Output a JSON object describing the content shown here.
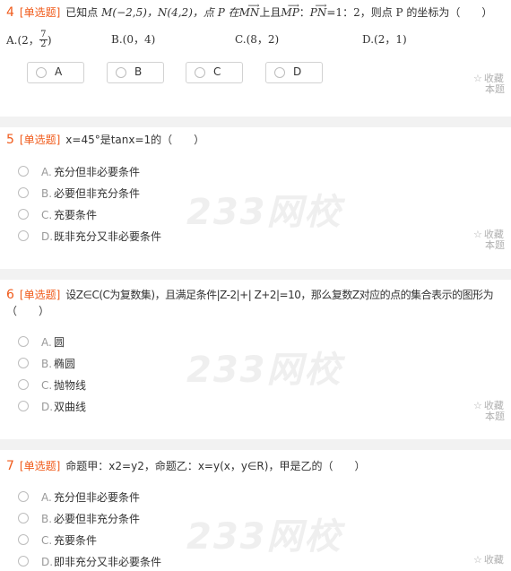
{
  "watermark": "233网校",
  "favorite": {
    "line1": "收藏",
    "line2": "本题",
    "icon": "star-outline-icon"
  },
  "q4": {
    "number": "4",
    "type": "[单选题]",
    "stem_a": "已知点",
    "stem_b": "M(−2,5)，N(4,2)，点 P 在",
    "vec_mn": "MN",
    "stem_c": "上且",
    "vec_mp": "MP",
    "colon": "：",
    "vec_pn": "PN",
    "stem_d": "=1：2，则点 P 的坐标为（　　）",
    "choices": [
      {
        "letter": "A.",
        "text_pre": "(2，",
        "frac_num": "7",
        "frac_den": "2",
        "text_post": ")"
      },
      {
        "letter": "B.",
        "text": "(0，4)"
      },
      {
        "letter": "C.",
        "text": "(8，2)"
      },
      {
        "letter": "D.",
        "text": "(2，1)"
      }
    ],
    "buttons": [
      "A",
      "B",
      "C",
      "D"
    ]
  },
  "q5": {
    "number": "5",
    "type": "[单选题]",
    "text": "x=45°是tanx=1的（　　）",
    "options": [
      {
        "letter": "A.",
        "text": "充分但非必要条件"
      },
      {
        "letter": "B.",
        "text": "必要但非充分条件"
      },
      {
        "letter": "C.",
        "text": "充要条件"
      },
      {
        "letter": "D.",
        "text": "既非充分又非必要条件"
      }
    ]
  },
  "q6": {
    "number": "6",
    "type": "[单选题]",
    "text_line1": "设Z∈C(C为复数集)，且满足条件|Z-2|+| Z+2|=10，那么复数Z对应的点的集合表示的图形为",
    "text_line2": "（　　）",
    "options": [
      {
        "letter": "A.",
        "text": "圆"
      },
      {
        "letter": "B.",
        "text": "椭圆"
      },
      {
        "letter": "C.",
        "text": "抛物线"
      },
      {
        "letter": "D.",
        "text": "双曲线"
      }
    ]
  },
  "q7": {
    "number": "7",
    "type": "[单选题]",
    "text": "命题甲：x2=y2，命题乙：x=y(x，y∈R)，甲是乙的（　　）",
    "options": [
      {
        "letter": "A.",
        "text": "充分但非必要条件"
      },
      {
        "letter": "B.",
        "text": "必要但非充分条件"
      },
      {
        "letter": "C.",
        "text": "充要条件"
      },
      {
        "letter": "D.",
        "text": "即非充分又非必要条件"
      }
    ]
  }
}
